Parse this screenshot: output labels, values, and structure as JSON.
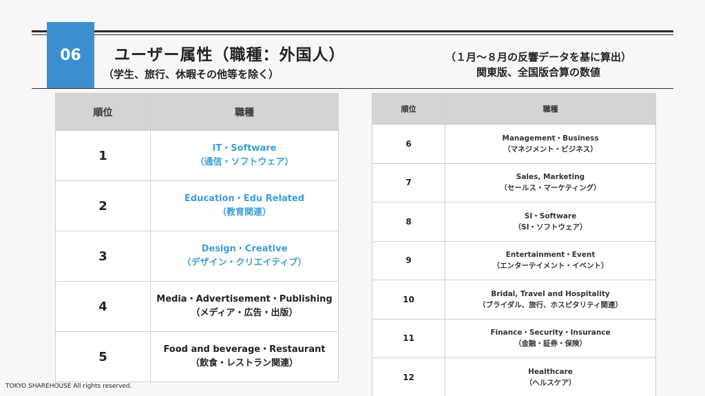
{
  "header": {
    "number": "06",
    "title": "ユーザー属性（職種：外国人）",
    "subtitle": "（学生、旅行、休暇その他等を除く）",
    "note_line1": "（１月～８月の反響データを基に算出）",
    "note_line2": "関東版、全国版合算の数値"
  },
  "columns": {
    "rank": "順位",
    "job": "職種"
  },
  "left_rows": [
    {
      "rank": "1",
      "en": "IT・Software",
      "jp": "（通信・ソフトウェア）"
    },
    {
      "rank": "2",
      "en": "Education・Edu Related",
      "jp": "（教育関連）"
    },
    {
      "rank": "3",
      "en": "Design・Creative",
      "jp": "（デザイン・クリエイティブ）"
    },
    {
      "rank": "4",
      "en": "Media・Advertisement・Publishing",
      "jp": "（メディア・広告・出版）"
    },
    {
      "rank": "5",
      "en": "Food and beverage・Restaurant",
      "jp": "（飲食・レストラン関連）"
    }
  ],
  "right_rows": [
    {
      "rank": "6",
      "en": "Management・Business",
      "jp": "（マネジメント・ビジネス）"
    },
    {
      "rank": "7",
      "en": "Sales, Marketing",
      "jp": "（セールス・マーケティング）"
    },
    {
      "rank": "8",
      "en": "SI・Software",
      "jp": "（SI・ソフトウェア）"
    },
    {
      "rank": "9",
      "en": "Entertainment・Event",
      "jp": "（エンターテイメント・イベント）"
    },
    {
      "rank": "10",
      "en": "Bridal, Travel and Hospitality",
      "jp": "（ブライダル、旅行、ホスピタリティ関連）"
    },
    {
      "rank": "11",
      "en": "Finance・Security・Insurance",
      "jp": "（金融・証券・保険）"
    },
    {
      "rank": "12",
      "en": "Healthcare",
      "jp": "（ヘルスケア）"
    }
  ],
  "footer": {
    "copyright": "TOKYO SHAREHOUSE  All rights reserved."
  },
  "colors": {
    "accent": "#3b8fd1",
    "highlight_text": "#3b9ed8",
    "header_cell": "#d4d4d4"
  }
}
